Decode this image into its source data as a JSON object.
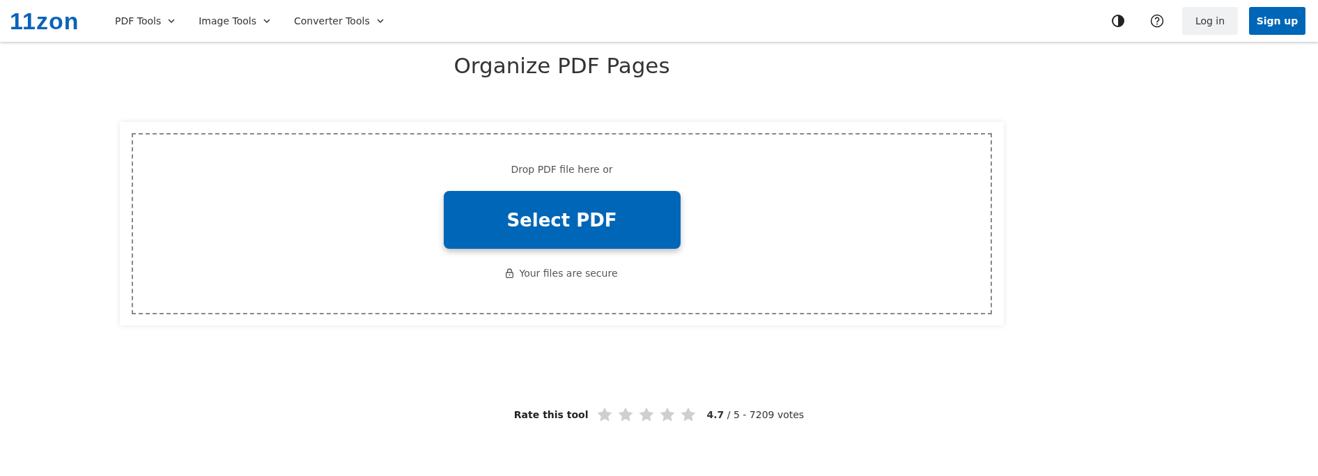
{
  "header": {
    "logo": "11zon",
    "nav": [
      {
        "label": "PDF Tools"
      },
      {
        "label": "Image Tools"
      },
      {
        "label": "Converter Tools"
      }
    ],
    "login": "Log in",
    "signup": "Sign up"
  },
  "title": "Organize PDF Pages",
  "upload": {
    "hint": "Drop PDF file here or",
    "button": "Select PDF",
    "secure": "Your files are secure"
  },
  "rating": {
    "label": "Rate this tool",
    "stars": 0,
    "summary": "**4.7** / 5 - 7209 votes"
  }
}
